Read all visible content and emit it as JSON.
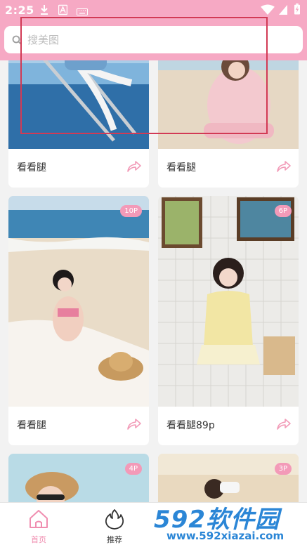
{
  "status_bar": {
    "time": "2:25"
  },
  "search": {
    "placeholder": "搜美图"
  },
  "cards": [
    {
      "title": "看看腿",
      "badge": ""
    },
    {
      "title": "看看腿",
      "badge": ""
    },
    {
      "title": "看看腿",
      "badge": "10P"
    },
    {
      "title": "看看腿89p",
      "badge": "6P"
    },
    {
      "title": "",
      "badge": "4P"
    },
    {
      "title": "",
      "badge": "3P"
    }
  ],
  "nav": {
    "tabs": [
      {
        "label": "首页",
        "active": true
      },
      {
        "label": "推荐",
        "active": false
      }
    ]
  },
  "watermark": {
    "brand": "592软件园",
    "url": "www.592xiazai.com"
  },
  "colors": {
    "accent": "#f6a9c4",
    "badge": "#f39ab8",
    "active_tab": "#f08eb0",
    "watermark": "#2b86d6"
  }
}
